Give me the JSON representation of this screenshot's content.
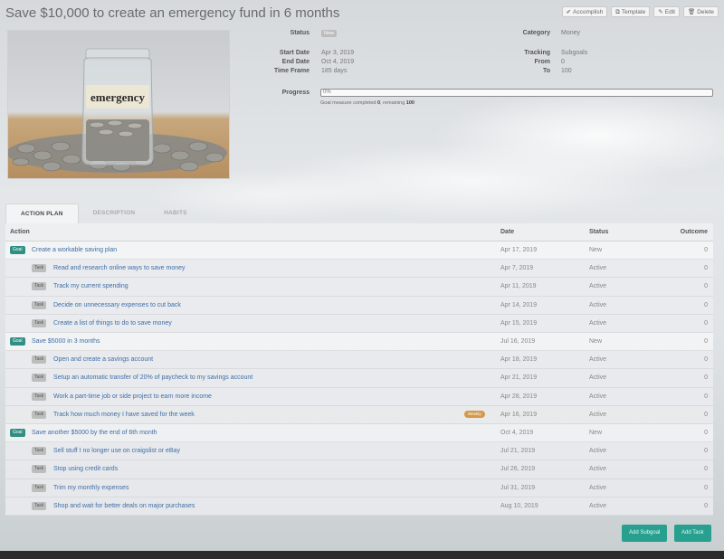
{
  "header": {
    "title": "Save $10,000 to create an emergency fund in 6 months",
    "toolbar": [
      {
        "icon": "check-icon",
        "glyph": "✔",
        "label": "Accomplish"
      },
      {
        "icon": "copy-icon",
        "glyph": "⧉",
        "label": "Template"
      },
      {
        "icon": "pencil-icon",
        "glyph": "✎",
        "label": "Edit"
      },
      {
        "icon": "trash-icon",
        "glyph": "🗑",
        "label": "Delete"
      }
    ]
  },
  "photo": {
    "jar_label": "emergency"
  },
  "details": {
    "status_label": "Status",
    "status_value": "New",
    "start_label": "Start Date",
    "start_value": "Apr 3, 2019",
    "end_label": "End Date",
    "end_value": "Oct 4, 2019",
    "timeframe_label": "Time Frame",
    "timeframe_value": "185 days",
    "category_label": "Category",
    "category_value": "Money",
    "tracking_label": "Tracking",
    "tracking_value": "Subgoals",
    "from_label": "From",
    "from_value": "0",
    "to_label": "To",
    "to_value": "100",
    "progress_label": "Progress",
    "progress_text": "0%",
    "progress_fraction": 0.0,
    "note_prefix": "Goal measure completed",
    "note_completed": "0",
    "note_mid": ", remaining",
    "note_remaining": "100"
  },
  "tabs": [
    {
      "label": "ACTION PLAN",
      "active": true
    },
    {
      "label": "DESCRIPTION",
      "active": false
    },
    {
      "label": "HABITS",
      "active": false
    }
  ],
  "table": {
    "headers": {
      "action": "Action",
      "date": "Date",
      "status": "Status",
      "outcome": "Outcome"
    },
    "rows": [
      {
        "type": "Goal",
        "text": "Create a workable saving plan",
        "date": "Apr 17, 2019",
        "status": "New",
        "outcome": "0"
      },
      {
        "type": "Task",
        "text": "Read and research online ways to save money",
        "date": "Apr 7, 2019",
        "status": "Active",
        "outcome": "0"
      },
      {
        "type": "Task",
        "text": "Track my current spending",
        "date": "Apr 11, 2019",
        "status": "Active",
        "outcome": "0"
      },
      {
        "type": "Task",
        "text": "Decide on unnecessary expenses to cut back",
        "date": "Apr 14, 2019",
        "status": "Active",
        "outcome": "0"
      },
      {
        "type": "Task",
        "text": "Create a list of things to do to save money",
        "date": "Apr 15, 2019",
        "status": "Active",
        "outcome": "0"
      },
      {
        "type": "Goal",
        "text": "Save $5000 in 3 months",
        "date": "Jul 16, 2019",
        "status": "New",
        "outcome": "0"
      },
      {
        "type": "Task",
        "text": "Open and create a savings account",
        "date": "Apr 18, 2019",
        "status": "Active",
        "outcome": "0"
      },
      {
        "type": "Task",
        "text": "Setup an automatic transfer of 20% of paycheck to my savings account",
        "date": "Apr 21, 2019",
        "status": "Active",
        "outcome": "0"
      },
      {
        "type": "Task",
        "text": "Work a part-time job or side project to earn more income",
        "date": "Apr 28, 2019",
        "status": "Active",
        "outcome": "0"
      },
      {
        "type": "Task",
        "text": "Track how much money I have saved for the week",
        "tag": "Weekly",
        "date": "Apr 16, 2019",
        "status": "Active",
        "outcome": "0"
      },
      {
        "type": "Goal",
        "text": "Save another $5000 by the end of 6th month",
        "date": "Oct 4, 2019",
        "status": "New",
        "outcome": "0"
      },
      {
        "type": "Task",
        "text": "Sell stuff I no longer use on craigslist or eBay",
        "date": "Jul 21, 2019",
        "status": "Active",
        "outcome": "0"
      },
      {
        "type": "Task",
        "text": "Stop using credit cards",
        "date": "Jul 26, 2019",
        "status": "Active",
        "outcome": "0"
      },
      {
        "type": "Task",
        "text": "Trim my monthly expenses",
        "date": "Jul 31, 2019",
        "status": "Active",
        "outcome": "0"
      },
      {
        "type": "Task",
        "text": "Shop and wait for better deals on major purchases",
        "date": "Aug 10, 2019",
        "status": "Active",
        "outcome": "0"
      }
    ]
  },
  "buttons": {
    "add_subgoal": "Add Subgoal",
    "add_task": "Add Task"
  }
}
